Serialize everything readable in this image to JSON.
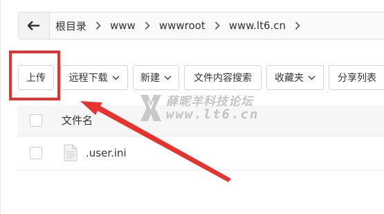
{
  "breadcrumb": {
    "back_icon": "arrow-left-icon",
    "items": [
      "根目录",
      "www",
      "wwwroot",
      "www.lt6.cn"
    ]
  },
  "toolbar": {
    "upload": "上传",
    "remote_download": "远程下载",
    "new": "新建",
    "content_search": "文件内容搜索",
    "favorites": "收藏夹",
    "share_list": "分享列表"
  },
  "list": {
    "header_filename": "文件名",
    "files": [
      {
        "name": ".user.ini",
        "icon": "file-icon"
      }
    ]
  },
  "watermark": {
    "title": "薛昵羊科技论坛",
    "url": "www.lt6.cn"
  },
  "annotation": {
    "highlight_color": "#e8322e",
    "arrow_color": "#e8322e"
  }
}
